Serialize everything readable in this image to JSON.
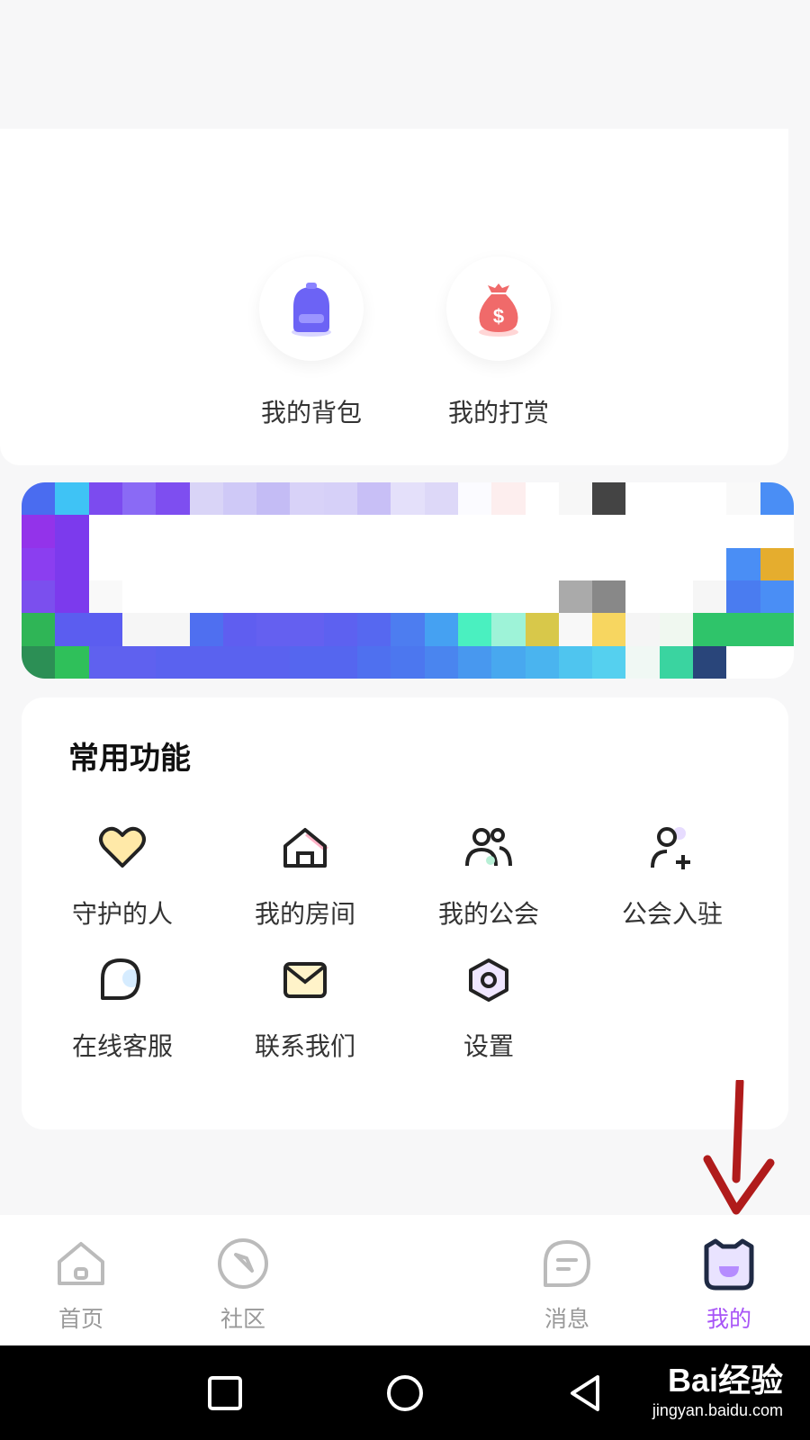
{
  "quick_actions": [
    {
      "label": "我的背包",
      "icon": "backpack-icon",
      "color": "#6c63f5"
    },
    {
      "label": "我的打赏",
      "icon": "money-bag-icon",
      "color": "#f06a6a"
    }
  ],
  "functions": {
    "title": "常用功能",
    "items": [
      {
        "label": "守护的人",
        "icon": "heart-icon"
      },
      {
        "label": "我的房间",
        "icon": "house-icon"
      },
      {
        "label": "我的公会",
        "icon": "group-icon"
      },
      {
        "label": "公会入驻",
        "icon": "add-user-icon"
      },
      {
        "label": "在线客服",
        "icon": "chat-bubble-icon"
      },
      {
        "label": "联系我们",
        "icon": "envelope-icon"
      },
      {
        "label": "设置",
        "icon": "settings-hexagon-icon"
      }
    ]
  },
  "tabbar": {
    "tabs": [
      {
        "label": "首页",
        "icon": "home-icon",
        "active": false
      },
      {
        "label": "社区",
        "icon": "compass-icon",
        "active": false
      },
      {
        "label": "消息",
        "icon": "message-icon",
        "active": false
      },
      {
        "label": "我的",
        "icon": "cat-avatar-icon",
        "active": true
      }
    ],
    "active_color": "#a855f7"
  },
  "watermark": {
    "logo": "Bai经验",
    "url": "jingyan.baidu.com"
  },
  "colors": {
    "accent": "#a855f7",
    "annotation_arrow": "#b01b1b"
  }
}
